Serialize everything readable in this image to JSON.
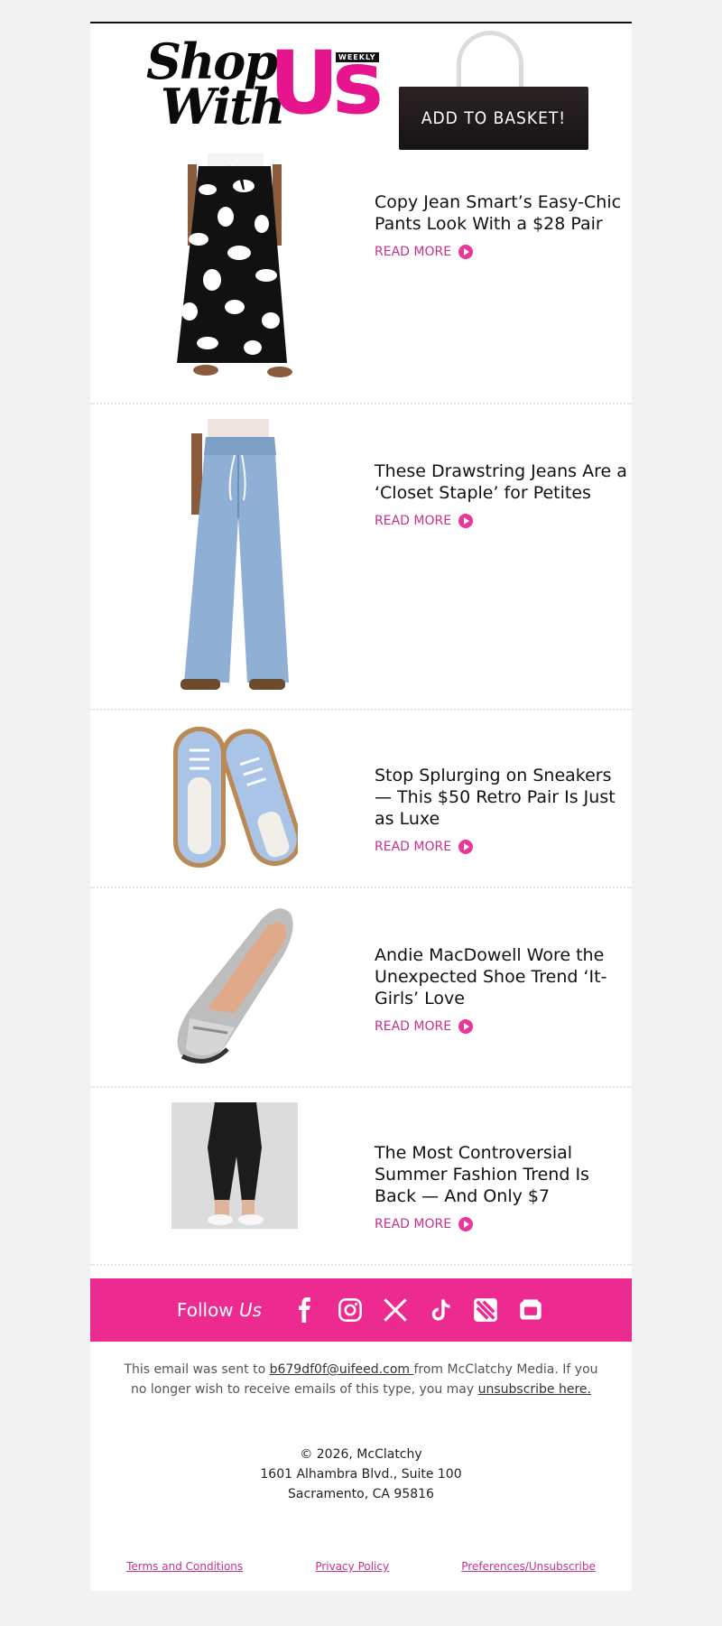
{
  "header": {
    "logo_shop": "Shop",
    "logo_with": "With",
    "logo_us": "Us",
    "logo_weekly": "WEEKLY",
    "basket_label": "ADD TO BASKET!"
  },
  "articles": [
    {
      "title": "Copy Jean Smart’s Easy-Chic Pants Look With a $28 Pair",
      "read_more": "READ MORE",
      "image": "floral-pants-image"
    },
    {
      "title": "These Drawstring Jeans Are a ‘Closet Staple’ for Petites",
      "read_more": "READ MORE",
      "image": "drawstring-jeans-image"
    },
    {
      "title": "Stop Splurging on Sneakers — This $50 Retro Pair Is Just as Luxe",
      "read_more": "READ MORE",
      "image": "retro-sneakers-image"
    },
    {
      "title": "Andie MacDowell Wore the Unexpected Shoe Trend ‘It-Girls’ Love",
      "read_more": "READ MORE",
      "image": "silver-loafer-image"
    },
    {
      "title": "The Most Controversial Summer Fashion Trend Is Back — And Only $7",
      "read_more": "READ MORE",
      "image": "capri-leggings-image"
    }
  ],
  "follow": {
    "label": "Follow",
    "label_us": "Us",
    "icons": [
      "facebook-icon",
      "instagram-icon",
      "x-icon",
      "tiktok-icon",
      "apple-news-icon",
      "google-news-icon"
    ]
  },
  "footer": {
    "notice_prefix": "This email was sent to ",
    "email": "b679df0f@uifeed.com ",
    "notice_middle": "from McClatchy Media. If you no longer wish to receive emails of this type, you may ",
    "unsubscribe_link": "unsubscribe here.",
    "copyright": "© 2026, McClatchy",
    "address_line1": "1601 Alhambra Blvd., Suite 100",
    "address_line2": "Sacramento, CA 95816",
    "terms": "Terms and Conditions",
    "privacy": "Privacy Policy",
    "preferences": "Preferences/Unsubscribe"
  },
  "colors": {
    "brand_pink": "#e6158e",
    "follow_bar": "#ec2a90",
    "link_pink": "#c8308c"
  }
}
